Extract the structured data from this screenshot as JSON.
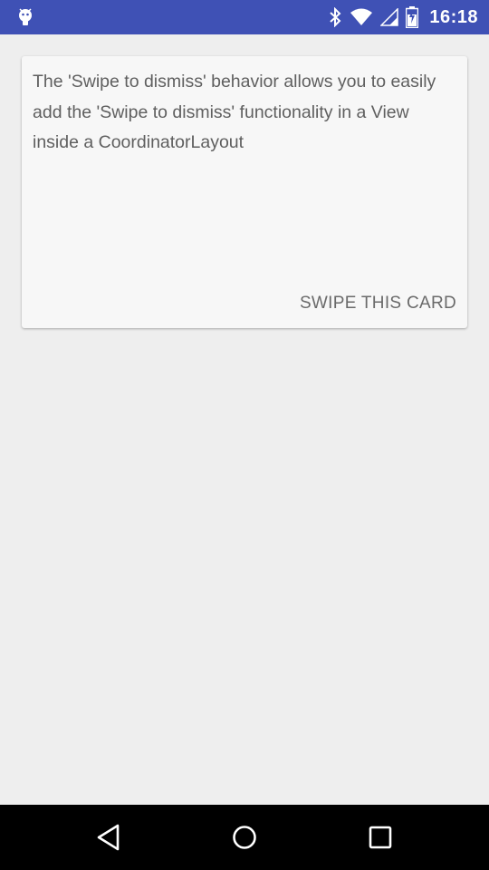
{
  "status_bar": {
    "time": "16:18",
    "background": "#3f51b5",
    "left_icon": "android-debug-icon",
    "icons": [
      "bluetooth-icon",
      "wifi-icon",
      "cellular-signal-icon",
      "battery-icon"
    ]
  },
  "card": {
    "text": "The 'Swipe to dismiss' behavior allows you to easily add the 'Swipe to dismiss' functionality in a View inside a CoordinatorLayout",
    "action_label": "SWIPE THIS CARD"
  },
  "nav_bar": {
    "buttons": [
      "back-icon",
      "home-icon",
      "recents-icon"
    ]
  }
}
